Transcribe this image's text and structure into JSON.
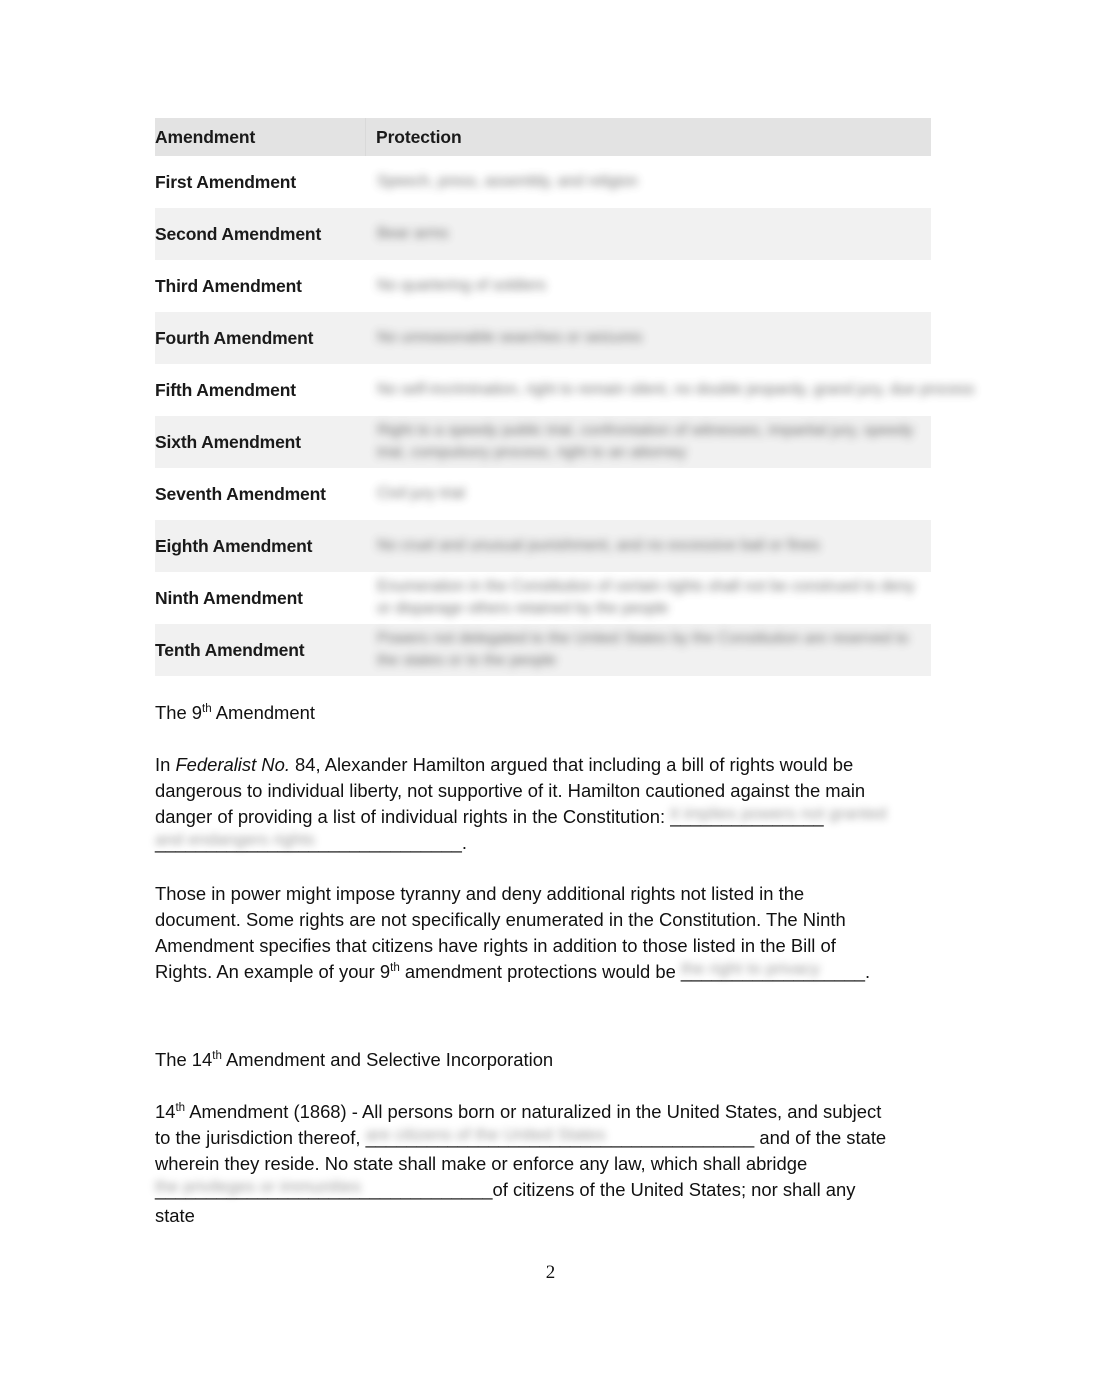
{
  "document": {
    "page_number": "2"
  },
  "table": {
    "headers": {
      "col1": "Amendment",
      "col2": "Protection"
    },
    "rows": [
      {
        "amendment": "First Amendment",
        "protection": "Speech, press, assembly, and religion"
      },
      {
        "amendment": "Second Amendment",
        "protection": "Bear arms"
      },
      {
        "amendment": "Third Amendment",
        "protection": "No quartering of soldiers"
      },
      {
        "amendment": "Fourth Amendment",
        "protection": "No unreasonable searches or seizures"
      },
      {
        "amendment": "Fifth Amendment",
        "protection": "No self-incrimination, right to remain silent, no double jeopardy, grand jury, due process"
      },
      {
        "amendment": "Sixth Amendment",
        "protection": "Right to a speedy public trial, confrontation of witnesses, impartial jury, speedy trial, compulsory process, right to an attorney"
      },
      {
        "amendment": "Seventh Amendment",
        "protection": "Civil jury trial"
      },
      {
        "amendment": "Eighth Amendment",
        "protection": "No cruel and unusual punishment, and no excessive bail or fines"
      },
      {
        "amendment": "Ninth Amendment",
        "protection": "Enumeration in the Constitution of certain rights shall not be construed to deny or disparage others retained by the people"
      },
      {
        "amendment": "Tenth Amendment",
        "protection": "Powers not delegated to the United States by the Constitution are reserved to the states or to the people"
      }
    ]
  },
  "sections": {
    "ninth": {
      "heading_prefix": "The 9",
      "heading_ord": "th",
      "heading_suffix": " Amendment",
      "para1": {
        "seg1": "In ",
        "italic": "Federalist No.",
        "seg2": " 84, Alexander Hamilton argued that including a bill of rights would be dangerous to individual liberty, not supportive of it. Hamilton cautioned against the main danger of providing a list of individual rights in the Constitution: ",
        "blank1": "_______________",
        "blank2": "______________________________",
        "seg3": ".",
        "redacted1": "it implies powers not granted",
        "redacted2": "and endangers rights"
      },
      "para2": {
        "seg1": "Those in power might impose tyranny and deny additional rights not listed in the document. Some rights are not specifically enumerated in the Constitution. The Ninth Amendment specifies that citizens have rights in addition to those listed in the Bill of Rights. An example of your 9",
        "ord": "th",
        "seg2": " amendment protections would be ",
        "blank": "__________________",
        "seg3": ".",
        "redacted": "the right to privacy"
      }
    },
    "fourteenth": {
      "heading_prefix": "The 14",
      "heading_ord": "th",
      "heading_suffix": " Amendment and Selective Incorporation",
      "para1": {
        "seg1": "14",
        "ord": "th",
        "seg2": " Amendment (1868) - All persons born or naturalized in the United States, and subject to the jurisdiction thereof, ",
        "blank1": "______________________________________",
        "seg3": " and of the state wherein they reside. No state shall make or enforce any law, which shall abridge ",
        "blank2": "_________________________________",
        "seg4": "of citizens of the United States; nor shall any state",
        "redacted1": "are citizens of the United States",
        "redacted2": "the privileges or immunities"
      }
    }
  }
}
